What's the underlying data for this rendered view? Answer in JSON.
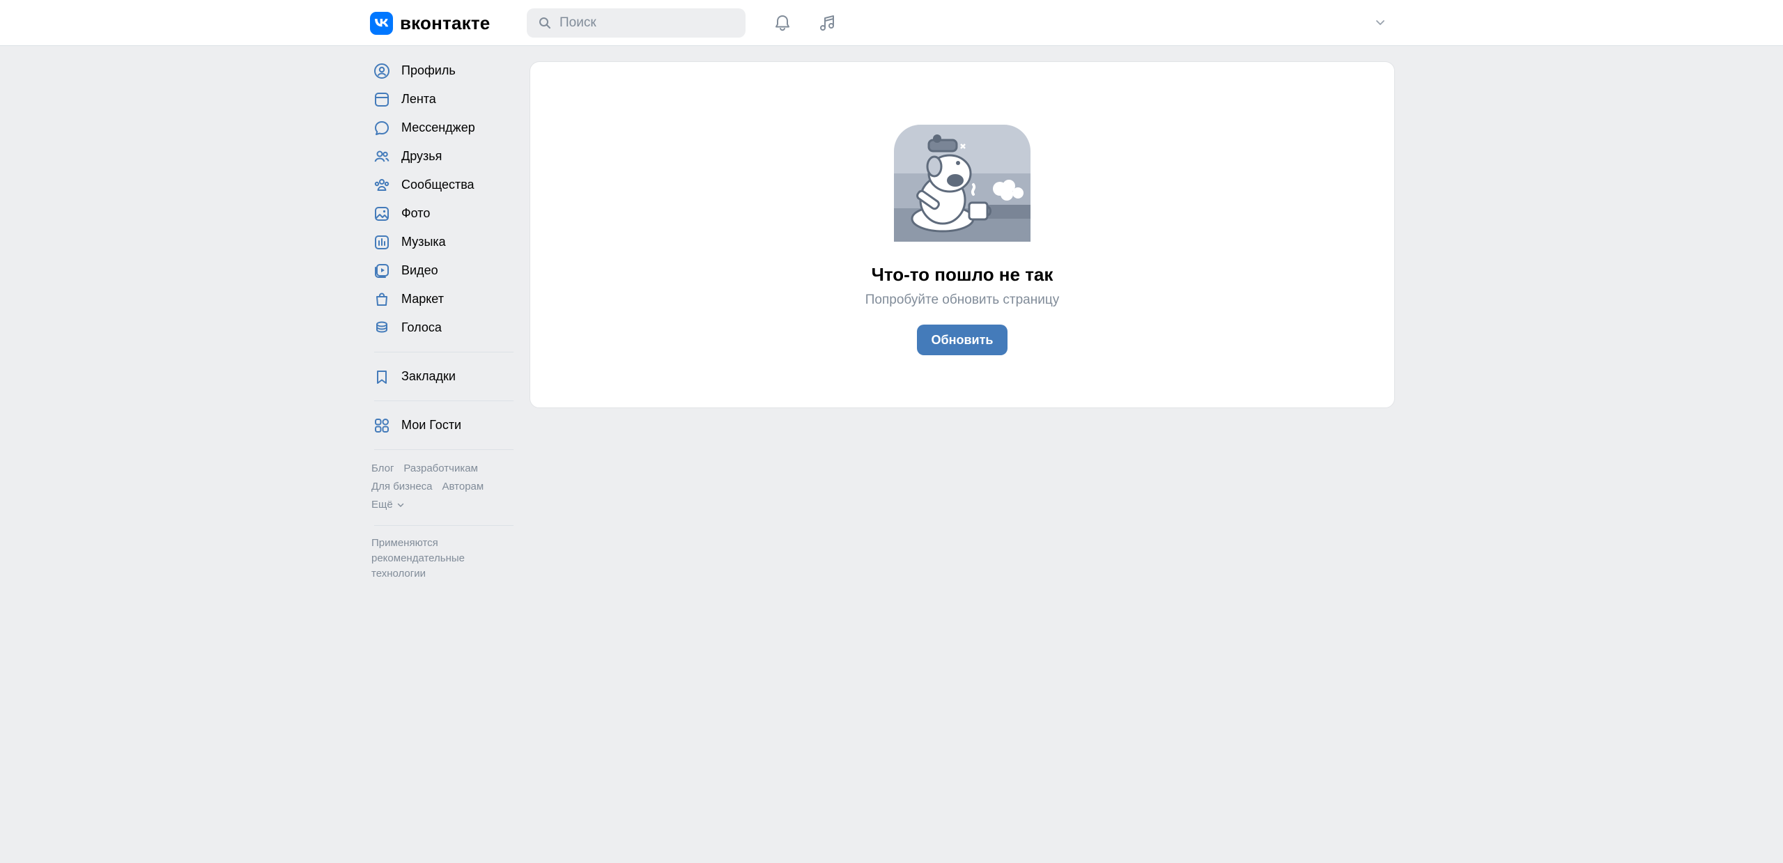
{
  "header": {
    "logo_text": "вконтакте",
    "search_placeholder": "Поиск"
  },
  "sidebar": {
    "items": [
      {
        "label": "Профиль",
        "icon": "user-circle-icon"
      },
      {
        "label": "Лента",
        "icon": "newsfeed-icon"
      },
      {
        "label": "Мессенджер",
        "icon": "message-icon"
      },
      {
        "label": "Друзья",
        "icon": "friends-icon"
      },
      {
        "label": "Сообщества",
        "icon": "communities-icon"
      },
      {
        "label": "Фото",
        "icon": "photo-icon"
      },
      {
        "label": "Музыка",
        "icon": "music-icon"
      },
      {
        "label": "Видео",
        "icon": "video-icon"
      },
      {
        "label": "Маркет",
        "icon": "market-bag-icon"
      },
      {
        "label": "Голоса",
        "icon": "coins-icon"
      }
    ],
    "bookmarks": "Закладки",
    "my_guests": "Мои Гости",
    "footer": {
      "blog": "Блог",
      "developers": "Разработчикам",
      "business": "Для бизнеса",
      "authors": "Авторам",
      "more": "Ещё"
    },
    "recommendation_note": "Применяются рекомендательные технологии"
  },
  "main": {
    "error_title": "Что-то пошло не так",
    "error_subtitle": "Попробуйте обновить страницу",
    "refresh_button": "Обновить"
  },
  "colors": {
    "accent": "#0077ff",
    "button": "#447bba",
    "icon": "#447bba",
    "background": "#edeef0",
    "muted_text": "#818c99"
  }
}
